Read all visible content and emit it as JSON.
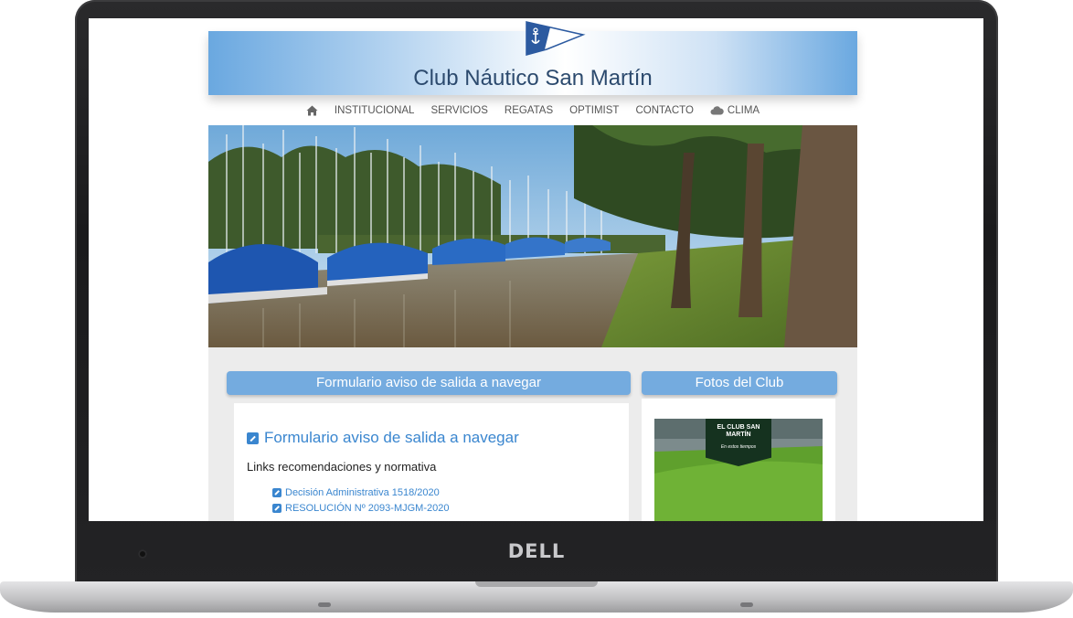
{
  "device": {
    "brand": "DELL"
  },
  "site": {
    "title": "Club Náutico San Martín",
    "nav": {
      "home_icon": "home-icon",
      "items": [
        "INSTITUCIONAL",
        "SERVICIOS",
        "REGATAS",
        "OPTIMIST",
        "CONTACTO"
      ],
      "weather": {
        "icon": "cloud-icon",
        "label": "CLIMA"
      }
    },
    "form_panel": {
      "header": "Formulario aviso de salida a navegar",
      "heading": "Formulario aviso de salida a navegar",
      "links_title": "Links recomendaciones y normativa",
      "links": [
        "Decisión Administrativa 1518/2020",
        "RESOLUCIÓN Nº 2093-MJGM-2020"
      ]
    },
    "photos_panel": {
      "header": "Fotos del Club",
      "photo_banner_title": "EL CLUB SAN MARTÍN",
      "photo_banner_subtitle": "En estos tiempos"
    },
    "colors": {
      "accent": "#74abdf",
      "link": "#3a86cf"
    }
  }
}
